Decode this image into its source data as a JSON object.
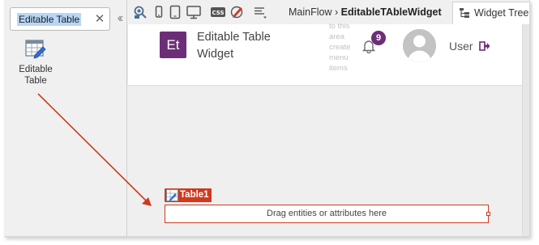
{
  "toolbox": {
    "search": {
      "value": "Editable Table"
    },
    "widget": {
      "label": "Editable Table"
    }
  },
  "toolbar": {
    "breadcrumb": {
      "flow": "MainFlow",
      "separator": "›",
      "screen": "EditableTAbleWidget"
    },
    "tree_tab": "Widget Tree",
    "css_label": "CSS",
    "icons": [
      "preview-icon",
      "phone-icon",
      "tablet-icon",
      "desktop-icon",
      "css-icon",
      "theme-editor-icon",
      "align-icon"
    ]
  },
  "app_header": {
    "logo_text": "Et",
    "title": "Editable Table Widget",
    "menu_hint": "to this area create menu items",
    "notification_count": "9",
    "user_name": "User"
  },
  "table_widget": {
    "name": "Table1",
    "placeholder": "Drag entities or attributes here"
  },
  "colors": {
    "accent_purple": "#6b2e77",
    "selection_red": "#d0391e",
    "search_highlight": "#b8d6f5"
  }
}
